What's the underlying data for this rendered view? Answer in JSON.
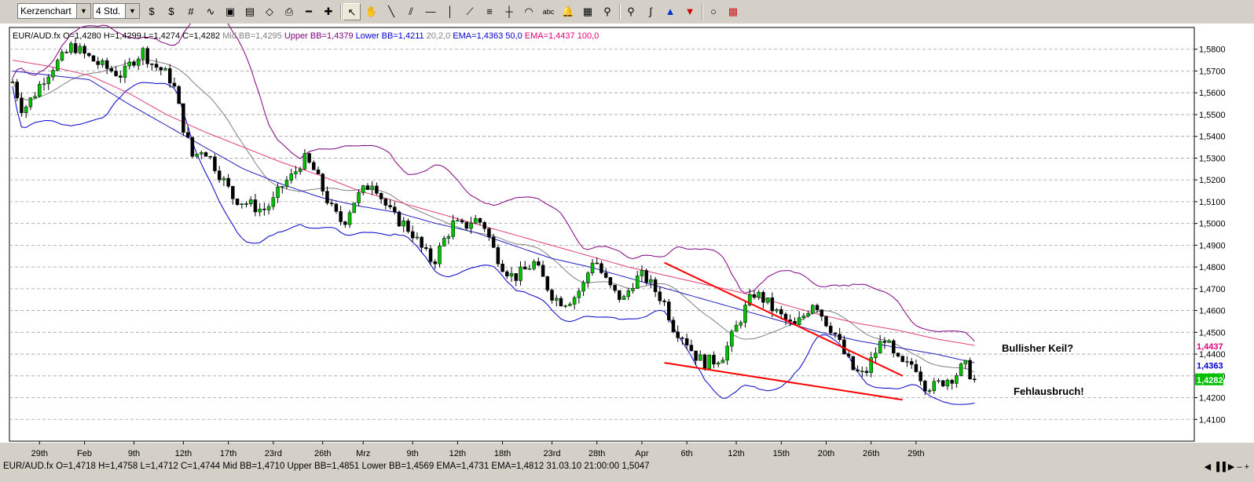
{
  "toolbar": {
    "chart_type": "Kerzenchart",
    "interval": "4 Std.",
    "tool_icons": [
      "pan-left-icon",
      "pan-right-icon",
      "grid-icon",
      "line-chart-icon",
      "image-icon",
      "photo-icon",
      "eraser-icon",
      "print-icon",
      "zoom-out-icon",
      "zoom-in-icon",
      "cursor-icon",
      "hand-icon",
      "line-tool-icon",
      "parallel-lines-icon",
      "hline-icon",
      "vline-icon",
      "fan-icon",
      "fibo-icon",
      "crosshair-icon",
      "arc-icon",
      "text-icon",
      "bell-icon",
      "calculator-icon",
      "magnifier-icon",
      "search-icon",
      "wave-icon",
      "arrow-up-icon",
      "arrow-down-icon",
      "circle-icon",
      "color-palette-icon"
    ],
    "text_tool": "abc"
  },
  "chart_data": {
    "type": "candlestick",
    "symbol": "EUR/AUD.fx",
    "legend": {
      "ohlc": "EUR/AUD.fx O=1,4280 H=1,4299 L=1,4274 C=1,4282",
      "mid_bb": "Mid BB=1,4295",
      "upper_bb": "Upper BB=1,4379",
      "lower_bb": "Lower BB=1,4211",
      "bb_params": "20,2,0",
      "ema50": "EMA=1,4363",
      "ema50_period": "50,0",
      "ema100": "EMA=1,4437",
      "ema100_period": "100,0"
    },
    "ylim": [
      1.4,
      1.59
    ],
    "y_ticks": [
      "1,5800",
      "1,5700",
      "1,5600",
      "1,5500",
      "1,5400",
      "1,5300",
      "1,5200",
      "1,5100",
      "1,5000",
      "1,4900",
      "1,4800",
      "1,4700",
      "1,4600",
      "1,4500",
      "1,4400",
      "1,4300",
      "1,4200",
      "1,4100"
    ],
    "y_tick_values": [
      1.58,
      1.57,
      1.56,
      1.55,
      1.54,
      1.53,
      1.52,
      1.51,
      1.5,
      1.49,
      1.48,
      1.47,
      1.46,
      1.45,
      1.44,
      1.43,
      1.42,
      1.41
    ],
    "x_ticks": [
      "29th",
      "Feb",
      "9th",
      "12th",
      "17th",
      "23rd",
      "26th",
      "Mrz",
      "9th",
      "12th",
      "18th",
      "23rd",
      "28th",
      "Apr",
      "6th",
      "12th",
      "15th",
      "20th",
      "26th",
      "29th"
    ],
    "x_tick_bars": [
      6,
      16,
      27,
      38,
      48,
      58,
      69,
      78,
      89,
      99,
      109,
      120,
      130,
      140,
      150,
      161,
      171,
      181,
      191,
      201
    ],
    "bars_total": 215,
    "close_path": [
      1.565,
      1.552,
      1.558,
      1.566,
      1.572,
      1.576,
      1.582,
      1.578,
      1.575,
      1.572,
      1.57,
      1.568,
      1.575,
      1.579,
      1.573,
      1.57,
      1.565,
      1.545,
      1.53,
      1.535,
      1.528,
      1.52,
      1.512,
      1.51,
      1.508,
      1.506,
      1.51,
      1.518,
      1.522,
      1.53,
      1.525,
      1.515,
      1.505,
      1.5,
      1.51,
      1.515,
      1.52,
      1.51,
      1.503,
      1.5,
      1.495,
      1.487,
      1.482,
      1.492,
      1.5,
      1.498,
      1.502,
      1.5,
      1.488,
      1.48,
      1.475,
      1.478,
      1.482,
      1.474,
      1.466,
      1.464,
      1.466,
      1.472,
      1.485,
      1.475,
      1.468,
      1.465,
      1.474,
      1.476,
      1.47,
      1.464,
      1.452,
      1.448,
      1.44,
      1.436,
      1.437,
      1.44,
      1.45,
      1.46,
      1.468,
      1.465,
      1.46,
      1.456,
      1.452,
      1.458,
      1.465,
      1.456,
      1.45,
      1.44,
      1.432,
      1.43,
      1.44,
      1.448,
      1.438,
      1.434,
      1.436,
      1.426,
      1.425,
      1.428,
      1.43,
      1.435,
      1.428
    ],
    "ema50": [
      1.57,
      1.568,
      1.566,
      1.555,
      1.545,
      1.535,
      1.525,
      1.518,
      1.512,
      1.508,
      1.505,
      1.5,
      1.496,
      1.49,
      1.484,
      1.48,
      1.475,
      1.47,
      1.465,
      1.46,
      1.455,
      1.45,
      1.446,
      1.443,
      1.44,
      1.436
    ],
    "ema100": [
      1.575,
      1.572,
      1.568,
      1.56,
      1.55,
      1.542,
      1.535,
      1.528,
      1.522,
      1.515,
      1.51,
      1.505,
      1.5,
      1.495,
      1.49,
      1.485,
      1.48,
      1.476,
      1.472,
      1.468,
      1.463,
      1.458,
      1.454,
      1.451,
      1.447,
      1.444
    ],
    "annotations": [
      {
        "label": "Bullisher Keil?",
        "color": "#000000"
      },
      {
        "label": "Fehlausbruch!",
        "color": "#000000"
      }
    ],
    "wedge_lines": {
      "upper": [
        [
          145,
          1.482
        ],
        [
          198,
          1.43
        ]
      ],
      "lower": [
        [
          145,
          1.436
        ],
        [
          198,
          1.419
        ]
      ],
      "color": "#ff0000"
    },
    "price_badges": [
      {
        "value": "1,4437",
        "color": "#e0007a",
        "text_color": "#e0007a"
      },
      {
        "value": "1,4363",
        "color": "#0000cc",
        "text_color": "#0000cc"
      },
      {
        "value": "1,4282",
        "color": "#00c000",
        "text_color": "#ffffff"
      }
    ],
    "colors": {
      "bull": "#00c000",
      "bear": "#000000",
      "upper_bb": "#800080",
      "lower_bb": "#0000cc",
      "mid_bb": "#808080",
      "ema50": "#2020c0",
      "ema100": "#e0407a",
      "grid": "#a0a0a0"
    },
    "grid": true
  },
  "status": {
    "text": "EUR/AUD.fx O=1,4718 H=1,4758 L=1,4712 C=1,4744  Mid BB=1,4710 Upper BB=1,4851 Lower BB=1,4569 EMA=1,4731 EMA=1,4812  31.03.10 21:00:00 1,5047"
  }
}
